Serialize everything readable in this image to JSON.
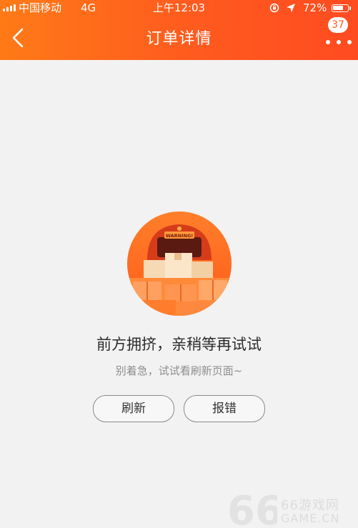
{
  "status_bar": {
    "carrier": "中国移动",
    "network": "4G",
    "time": "上午12:03",
    "battery": "72%",
    "battery_level": 0.72,
    "icons": [
      "signal-icon",
      "rotation-lock-icon",
      "location-icon",
      "battery-icon"
    ]
  },
  "header": {
    "title": "订单详情",
    "badge": "37",
    "back_icon": "chevron-left-icon",
    "more_icon": "more-dots-icon",
    "colors": {
      "start": "#ff7a17",
      "end": "#ff4b20"
    }
  },
  "error": {
    "illustration_sign": "WARNING!",
    "title": "前方拥挤，亲稍等再试试",
    "subtitle": "别着急，试试看刷新页面~",
    "refresh_label": "刷新",
    "report_label": "报错"
  },
  "watermark": {
    "logo": "66",
    "text_cn": "66游戏网",
    "text_en": "GAME.CN"
  }
}
